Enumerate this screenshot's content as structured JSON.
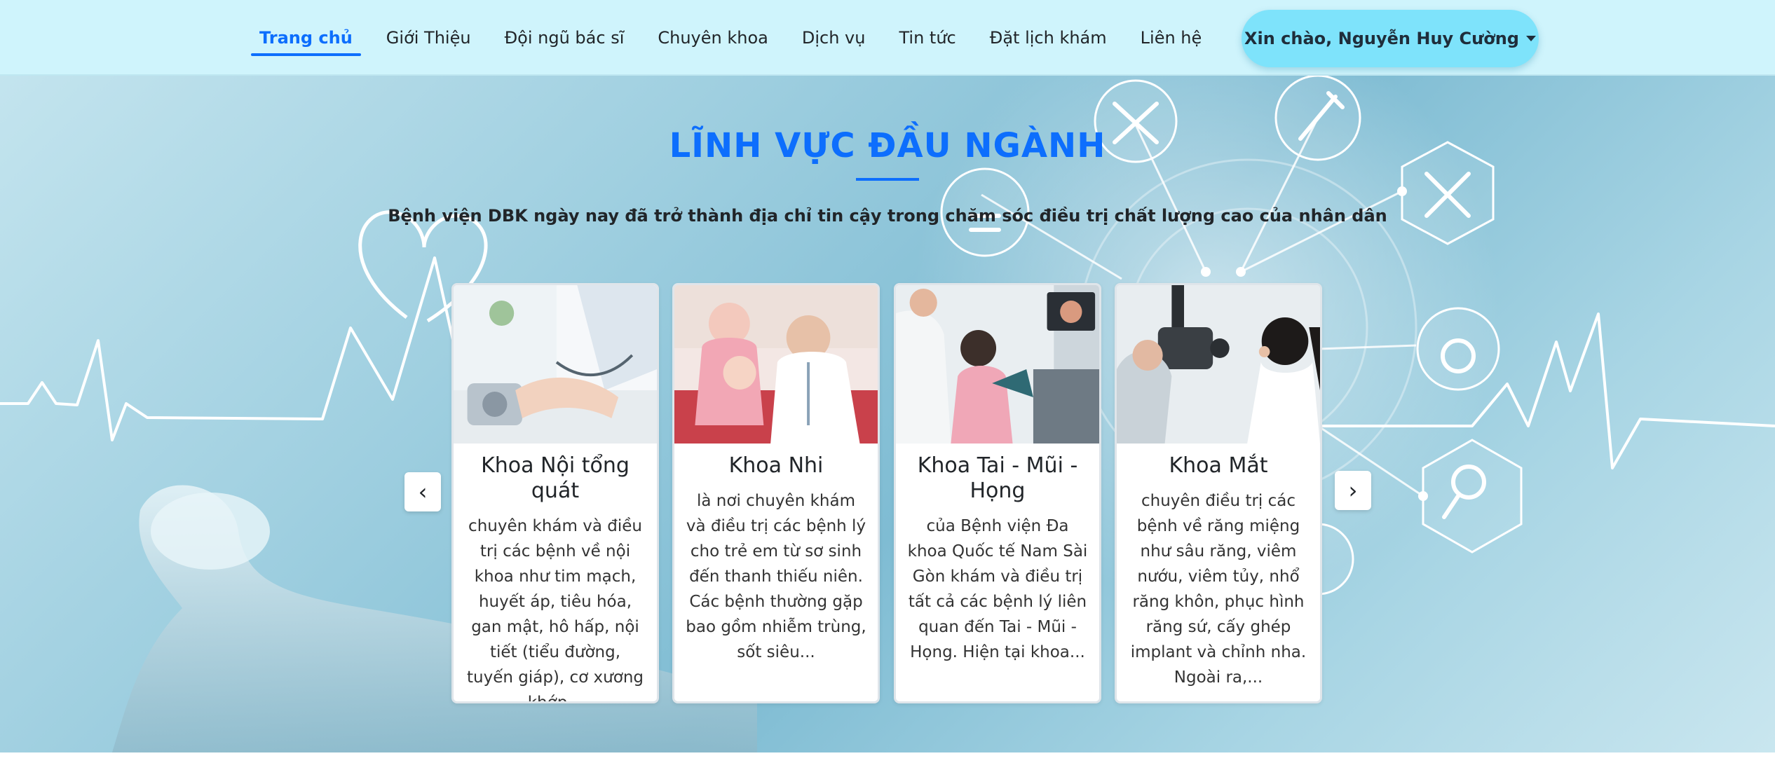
{
  "nav": {
    "items": [
      {
        "label": "Trang chủ",
        "active": true
      },
      {
        "label": "Giới Thiệu",
        "active": false
      },
      {
        "label": "Đội ngũ bác sĩ",
        "active": false
      },
      {
        "label": "Chuyên khoa",
        "active": false
      },
      {
        "label": "Dịch vụ",
        "active": false
      },
      {
        "label": "Tin tức",
        "active": false
      },
      {
        "label": "Đặt lịch khám",
        "active": false
      },
      {
        "label": "Liên hệ",
        "active": false
      }
    ],
    "user_greeting": "Xin chào, Nguyễn Huy Cường"
  },
  "hero": {
    "title": "LĨNH VỰC ĐẦU NGÀNH",
    "subtitle": "Bệnh viện DBK ngày nay đã trở thành địa chỉ tin cậy trong chăm sóc điều trị chất lượng cao của nhân dân"
  },
  "carousel": {
    "prev_label": "‹",
    "next_label": "›",
    "cards": [
      {
        "title": "Khoa Nội tổng quát",
        "text": "chuyên khám và điều trị các bệnh về nội khoa như tim mạch, huyết áp, tiêu hóa, gan mật, hô hấp, nội tiết (tiểu đường, tuyến giáp), cơ xương khớp..."
      },
      {
        "title": "Khoa Nhi",
        "text": "là nơi chuyên khám và điều trị các bệnh lý cho trẻ em từ sơ sinh đến thanh thiếu niên. Các bệnh thường gặp bao gồm nhiễm trùng, sốt siêu..."
      },
      {
        "title": "Khoa Tai - Mũi - Họng",
        "text": "của Bệnh viện Đa khoa Quốc tế Nam Sài Gòn khám và điều trị tất cả các bệnh lý liên quan đến Tai - Mũi - Họng. Hiện tại khoa..."
      },
      {
        "title": "Khoa Mắt",
        "text": "chuyên điều trị các bệnh về răng miệng như sâu răng, viêm nướu, viêm tủy, nhổ răng khôn, phục hình răng sứ, cấy ghép implant và chỉnh nha. Ngoài ra,..."
      }
    ]
  },
  "colors": {
    "nav_bg": "#cff4fc",
    "accent": "#0d6efd",
    "user_button_bg": "#7ee3fb"
  }
}
